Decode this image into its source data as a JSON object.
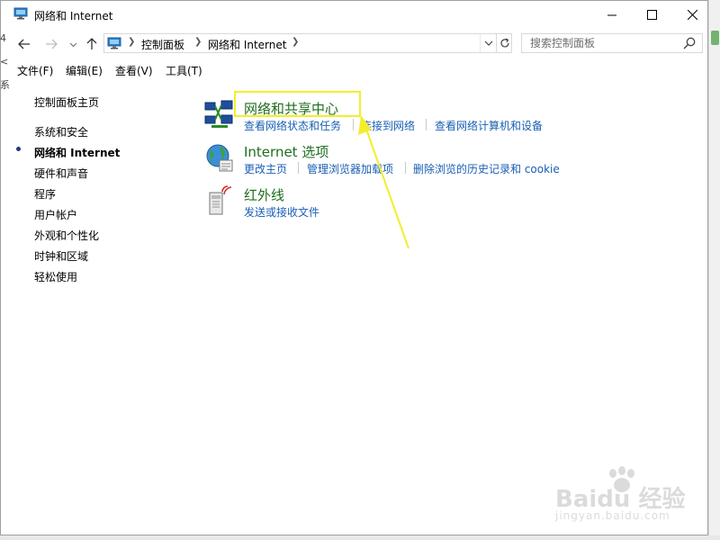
{
  "window": {
    "title": "网络和 Internet"
  },
  "address": {
    "crumbs": [
      "控制面板",
      "网络和 Internet"
    ],
    "search_placeholder": "搜索控制面板"
  },
  "menu": [
    "文件(F)",
    "编辑(E)",
    "查看(V)",
    "工具(T)"
  ],
  "sidebar": {
    "home": "控制面板主页",
    "items": [
      {
        "label": "系统和安全",
        "active": false
      },
      {
        "label": "网络和 Internet",
        "active": true
      },
      {
        "label": "硬件和声音",
        "active": false
      },
      {
        "label": "程序",
        "active": false
      },
      {
        "label": "用户帐户",
        "active": false
      },
      {
        "label": "外观和个性化",
        "active": false
      },
      {
        "label": "时钟和区域",
        "active": false
      },
      {
        "label": "轻松使用",
        "active": false
      }
    ]
  },
  "categories": [
    {
      "title": "网络和共享中心",
      "icon": "network-sharing-icon",
      "links": [
        "查看网络状态和任务",
        "连接到网络",
        "查看网络计算机和设备"
      ]
    },
    {
      "title": "Internet 选项",
      "icon": "internet-options-globe-icon",
      "links": [
        "更改主页",
        "管理浏览器加载项",
        "删除浏览的历史记录和 cookie"
      ]
    },
    {
      "title": "红外线",
      "icon": "infrared-icon",
      "links": [
        "发送或接收文件"
      ]
    }
  ],
  "colors": {
    "category_title": "#1e6e1e",
    "link": "#1a5fb4",
    "annotation": "#f2ee2c"
  },
  "watermark": {
    "brand": "Baidu 经验",
    "site": "jingyan.baidu.com"
  }
}
